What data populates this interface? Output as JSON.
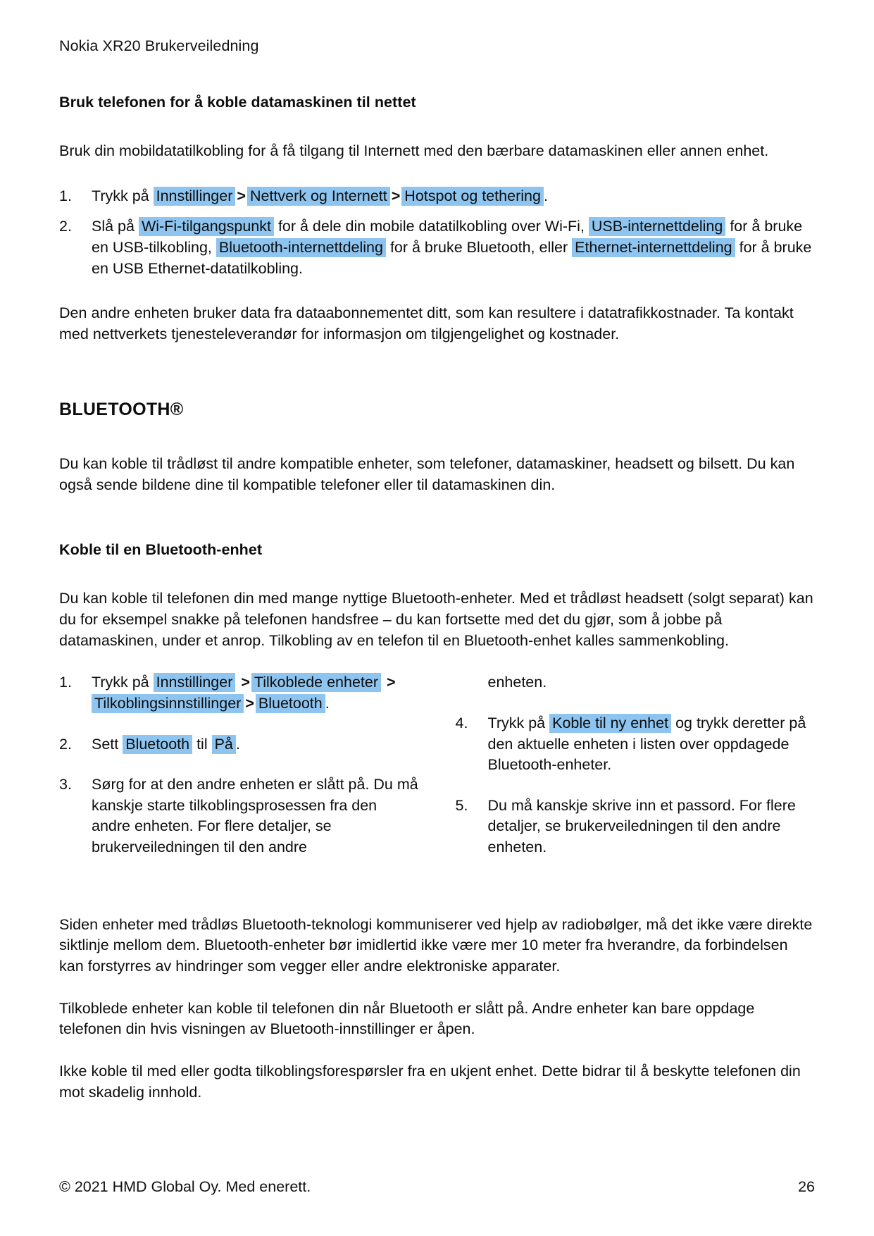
{
  "document": {
    "running_head": "Nokia XR20 Brukerveiledning"
  },
  "section_tethering": {
    "heading": "Bruk telefonen for å koble datamaskinen til nettet",
    "intro": "Bruk din mobildatatilkobling for å få tilgang til Internett med den bærbare datamaskinen eller annen enhet.",
    "steps": [
      {
        "marker": "1.",
        "lead": "Trykk på",
        "ui_1": "Innstillinger",
        "sep_1": ">",
        "ui_2": "Nettverk og Internett",
        "sep_2": ">",
        "ui_3": "Hotspot og tethering",
        "tail": "."
      },
      {
        "marker": "2.",
        "lead": "Slå på",
        "ui_1": "Wi-Fi-tilgangspunkt",
        "text_1": "for å dele din mobile datatilkobling over Wi-Fi,",
        "ui_2": "USB-internettdeling",
        "text_2": "for å bruke en USB-tilkobling,",
        "ui_3": "Bluetooth-internettdeling",
        "text_3": "for å bruke Bluetooth, eller",
        "ui_4": "Ethernet-internettdeling",
        "text_4": "for å bruke en USB Ethernet-datatilkobling."
      }
    ],
    "outro": "Den andre enheten bruker data fra dataabonnementet ditt, som kan resultere i datatrafikkostnader. Ta kontakt med nettverkets tjenesteleverandør for informasjon om tilgjengelighet og kostnader."
  },
  "section_bluetooth": {
    "heading": "BLUETOOTH®",
    "intro": "Du kan koble til trådløst til andre kompatible enheter, som telefoner, datamaskiner, headsett og bilsett. Du kan også sende bildene dine til kompatible telefoner eller til datamaskinen din.",
    "subheading": "Koble til en Bluetooth-enhet",
    "sub_intro": "Du kan koble til telefonen din med mange nyttige Bluetooth-enheter. Med et trådløst headsett (solgt separat) kan du for eksempel snakke på telefonen handsfree – du kan fortsette med det du gjør, som å jobbe på datamaskinen, under et anrop. Tilkobling av en telefon til en Bluetooth-enhet kalles sammenkobling.",
    "steps_left": [
      {
        "marker": "1.",
        "lead": "Trykk på",
        "ui_1": "Innstillinger",
        "sep_1": ">",
        "ui_2": "Tilkoblede enheter",
        "sep_2": ">",
        "ui_3": "Tilkoblingsinnstillinger",
        "sep_3": ">",
        "ui_4": "Bluetooth",
        "tail": "."
      },
      {
        "marker": "2.",
        "lead": "Sett",
        "ui_1": "Bluetooth",
        "text_1": "til",
        "ui_2": "På",
        "tail": "."
      },
      {
        "marker": "3.",
        "text": "Sørg for at den andre enheten er slått på. Du må kanskje starte tilkoblingsprosessen fra den andre enheten. For flere detaljer, se brukerveiledningen til den andre"
      }
    ],
    "steps_right": [
      {
        "continuation": "enheten."
      },
      {
        "marker": "4.",
        "lead": "Trykk på",
        "ui_1": "Koble til ny enhet",
        "text_1": "og trykk deretter på den aktuelle enheten i listen over oppdagede Bluetooth-enheter."
      },
      {
        "marker": "5.",
        "text": "Du må kanskje skrive inn et passord. For flere detaljer, se brukerveiledningen til den andre enheten."
      }
    ],
    "note_1": "Siden enheter med trådløs Bluetooth-teknologi kommuniserer ved hjelp av radiobølger, må det ikke være direkte siktlinje mellom dem. Bluetooth-enheter bør imidlertid ikke være mer 10 meter fra hverandre, da forbindelsen kan forstyrres av hindringer som vegger eller andre elektroniske apparater.",
    "note_2": "Tilkoblede enheter kan koble til telefonen din når Bluetooth er slått på. Andre enheter kan bare oppdage telefonen din hvis visningen av Bluetooth-innstillinger er åpen.",
    "note_3": "Ikke koble til med eller godta tilkoblingsforespørsler fra en ukjent enhet. Dette bidrar til å beskytte telefonen din mot skadelig innhold."
  },
  "footer": {
    "copyright": "© 2021 HMD Global Oy. Med enerett.",
    "page_number": "26"
  },
  "colors": {
    "highlight": "#8ec5f0",
    "text": "#0d0d0d",
    "page_background": "#ffffff"
  }
}
